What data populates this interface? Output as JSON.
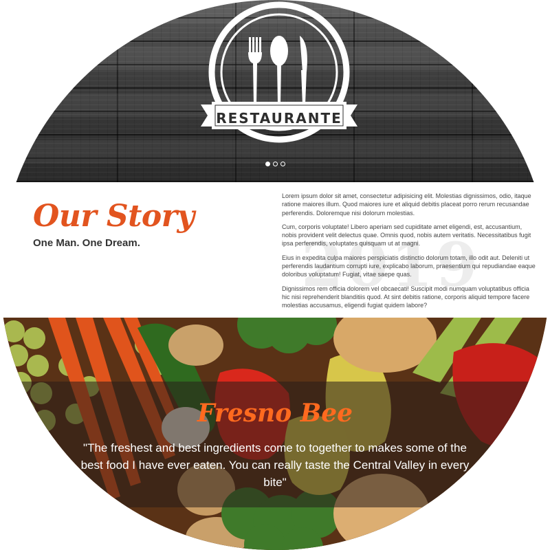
{
  "hero": {
    "logo_text": "RESTAURANTE",
    "logo_icons": [
      "fork-icon",
      "spoon-icon",
      "knife-icon"
    ],
    "slider_dots": {
      "count": 3,
      "active_index": 0
    }
  },
  "story": {
    "heading": "Our Story",
    "subheading": "One Man. One Dream.",
    "watermark": "2019",
    "paragraphs": [
      "Lorem ipsum dolor sit amet, consectetur adipisicing elit. Molestias dignissimos, odio, itaque ratione maiores illum. Quod maiores iure et aliquid debitis placeat porro rerum recusandae perferendis. Doloremque nisi dolorum molestias.",
      "Cum, corporis voluptate! Libero aperiam sed cupiditate amet eligendi, est, accusantium, nobis provident velit delectus quae. Omnis quod, nobis autem veritatis. Necessitatibus fugit ipsa perferendis, voluptates quisquam ut at magni.",
      "Eius in expedita culpa maiores perspiciatis distinctio dolorum totam, illo odit aut. Deleniti ut perferendis laudantium corrupti iure, explicabo laborum, praesentium qui repudiandae eaque doloribus voluptatum! Fugiat, vitae saepe quas.",
      "Dignissimos rem officia dolorem vel obcaecati! Suscipit modi numquam voluptatibus officia hic nisi reprehenderit blanditiis quod. At sint debitis ratione, corporis aliquid tempore facere molestias accusamus, eligendi fugiat quidem labore?"
    ]
  },
  "testimonial": {
    "source": "Fresno Bee",
    "quote": "\"The freshest and best ingredients come to together to makes some of the best food I have ever eaten. You can really taste the Central Valley in every bite\""
  },
  "colors": {
    "accent": "#e2541f",
    "quote_title": "#ff6a1f",
    "subheading": "#333333",
    "body_text": "#444444"
  }
}
